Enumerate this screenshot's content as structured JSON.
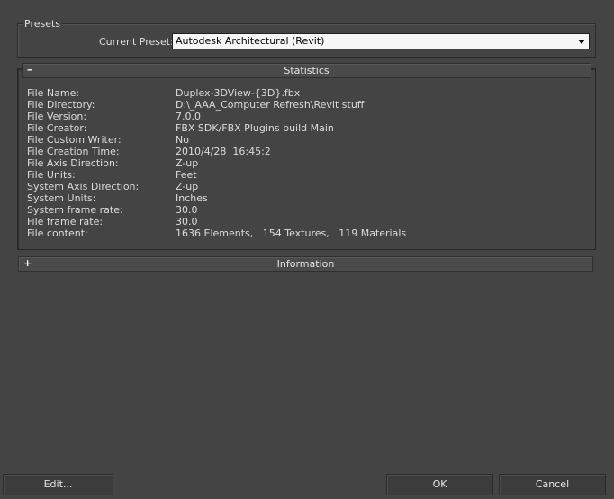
{
  "presets": {
    "group_label": "Presets",
    "current_preset_label": "Current Preset:",
    "current_preset_value": "Autodesk Architectural (Revit)"
  },
  "statistics": {
    "toggle": "–",
    "title": "Statistics",
    "rows": [
      {
        "label": "File Name:",
        "value": "Duplex-3DView-{3D}.fbx"
      },
      {
        "label": "File Directory:",
        "value": "D:\\_AAA_Computer Refresh\\Revit stuff"
      },
      {
        "label": "File Version:",
        "value": "7.0.0"
      },
      {
        "label": "File Creator:",
        "value": "FBX SDK/FBX Plugins build Main"
      },
      {
        "label": "File Custom Writer:",
        "value": "No"
      },
      {
        "label": "File Creation Time:",
        "value": "2010/4/28  16:45:2"
      },
      {
        "label": "File Axis Direction:",
        "value": "Z-up"
      },
      {
        "label": "File Units:",
        "value": "Feet"
      },
      {
        "label": "System Axis Direction:",
        "value": "Z-up"
      },
      {
        "label": "System Units:",
        "value": "Inches"
      },
      {
        "label": "System frame rate:",
        "value": "30.0"
      },
      {
        "label": "File frame rate:",
        "value": "30.0"
      },
      {
        "label": "File content:",
        "value": "1636 Elements,   154 Textures,   119 Materials"
      }
    ]
  },
  "information": {
    "toggle": "+",
    "title": "Information"
  },
  "buttons": {
    "edit": "Edit...",
    "ok": "OK",
    "cancel": "Cancel"
  }
}
